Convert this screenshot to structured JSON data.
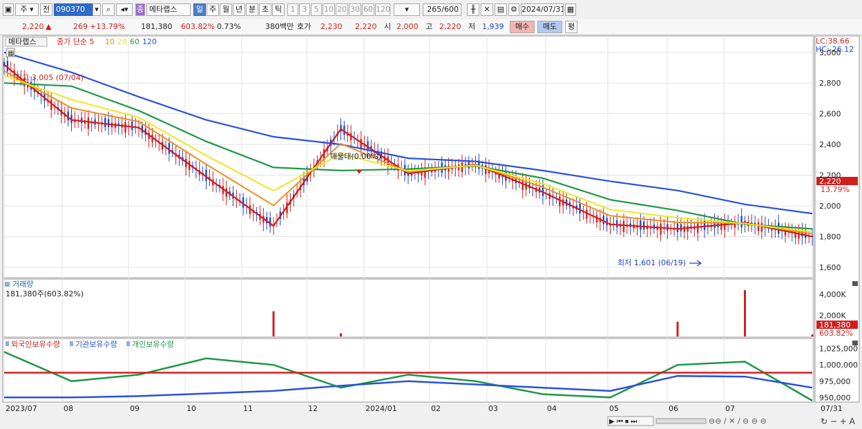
{
  "toolbar": {
    "period": "주",
    "prev": "전",
    "code": "090370",
    "stock_type": "종",
    "stock_name": "메타랩스",
    "periods": [
      "일",
      "주",
      "월",
      "년",
      "분",
      "초",
      "틱"
    ],
    "active_period": "일",
    "intervals": [
      "1",
      "3",
      "5",
      "10",
      "20",
      "30",
      "60",
      "120"
    ],
    "count": "265",
    "count_total": "/600",
    "date": "2024/07/31"
  },
  "quote": {
    "price": "2,220",
    "change_arrow": "▲",
    "change": "269",
    "change_pct": "+13.79%",
    "volume": "181,380",
    "volume_ratio": "603.82%",
    "turnover": "0.73%",
    "amount": "380백만",
    "bid_label": "호가",
    "ask": "2,230",
    "bid": "2,220",
    "open_label": "시",
    "open": "2,000",
    "high_label": "고",
    "high": "2,220",
    "low_label": "저",
    "low": "1,939",
    "buy": "매수",
    "sell": "매도",
    "eval": "평"
  },
  "price_panel": {
    "name_tag": "메타랩스",
    "ma_legend": [
      "종가 단순 5",
      "10",
      "20",
      "60",
      "120"
    ],
    "lc": "LC:38.66",
    "hc": "HC:-26.12",
    "high_note": "최고 3,005 (07/04)",
    "low_note": "최저 1,601 (06/19)",
    "mid_note": "매물대(0.00%)",
    "last_price_tag": "2,220",
    "last_pct_tag": "13.79%",
    "y_ticks": [
      "3,000",
      "2,800",
      "2,600",
      "2,400",
      "2,200",
      "2,000",
      "1,800",
      "1,600"
    ]
  },
  "volume_panel": {
    "title": "거래량",
    "summary": "181,380주(603.82%)",
    "y_ticks": [
      "4,000K",
      "2,000K"
    ],
    "last_tag": "181,380",
    "last_pct": "603.82%"
  },
  "holdings_panel": {
    "legend": [
      "외국인보유수량",
      "기관보유수량",
      "개인보유수량"
    ],
    "y_ticks": [
      "1,025,000",
      "1,000,000",
      "975,000",
      "950,000"
    ]
  },
  "x_axis": [
    "2023/07",
    "08",
    "09",
    "10",
    "11",
    "12",
    "2024/01",
    "02",
    "03",
    "04",
    "05",
    "06",
    "07",
    "07/31"
  ],
  "colors": {
    "up": "#d21e1e",
    "down": "#1e46c8",
    "ma5": "#d21e1e",
    "ma10": "#f08c1e",
    "ma20": "#f0e61e",
    "ma60": "#1e9646",
    "ma120": "#2850dc",
    "foreign": "#1e9646",
    "institution": "#d21e1e",
    "individual": "#2850dc"
  },
  "chart_data": {
    "type": "line",
    "x": [
      "2023/07",
      "08",
      "09",
      "10",
      "11",
      "12",
      "2024/01",
      "02",
      "03",
      "04",
      "05",
      "06",
      "07"
    ],
    "series": [
      {
        "name": "종가 단순 5",
        "values": [
          2920,
          2560,
          2510,
          2190,
          1870,
          2500,
          2210,
          2270,
          2090,
          1880,
          1850,
          1890,
          1800
        ]
      },
      {
        "name": "60",
        "values": [
          2800,
          2780,
          2620,
          2420,
          2250,
          2230,
          2240,
          2260,
          2180,
          2040,
          1970,
          1880,
          1850
        ]
      },
      {
        "name": "120",
        "values": [
          3000,
          2870,
          2710,
          2560,
          2450,
          2400,
          2310,
          2290,
          2230,
          2160,
          2100,
          2010,
          1950
        ]
      }
    ],
    "volume_k": [
      0,
      0,
      0,
      0,
      2400,
      300,
      0,
      0,
      0,
      0,
      1400,
      4400,
      181
    ],
    "holdings": {
      "foreign": [
        1020000,
        975000,
        985000,
        1010000,
        1000000,
        965000,
        985000,
        975000,
        955000,
        950000,
        1000000,
        1005000,
        945000
      ],
      "institution": [
        988000,
        988000,
        988000,
        988000,
        988000,
        988000,
        988000,
        988000,
        988000,
        988000,
        988000,
        988000,
        988000
      ],
      "individual": [
        950000,
        950000,
        952000,
        956000,
        960000,
        968000,
        975000,
        970000,
        965000,
        960000,
        983000,
        982000,
        965000
      ]
    },
    "ylim": [
      1550,
      3080
    ],
    "title": ""
  }
}
